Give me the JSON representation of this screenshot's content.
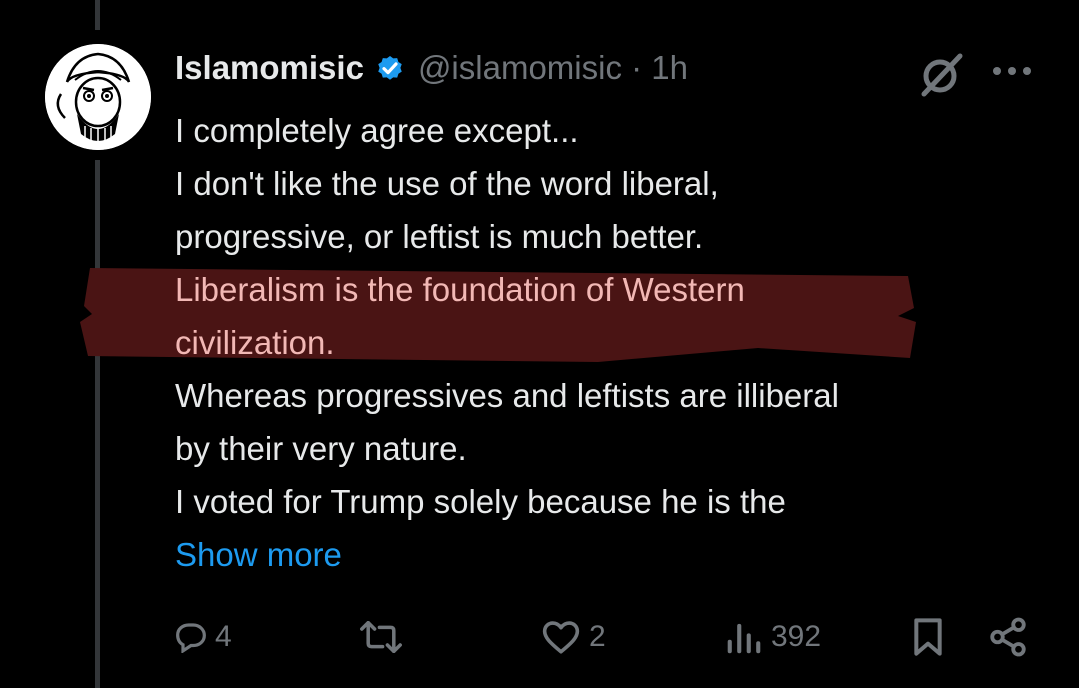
{
  "tweet": {
    "display_name": "Islamomisic",
    "handle_time": "@islamomisic · 1h",
    "lines": [
      "I completely agree except...",
      "I don't like the use of the word liberal,",
      "progressive, or leftist is much better.",
      "Liberalism is the foundation of Western",
      "civilization.",
      "Whereas progressives and leftists are illiberal",
      "by their very nature.",
      "I voted for Trump solely because he is the"
    ],
    "show_more": "Show more"
  },
  "actions": {
    "replies": "4",
    "reposts": "",
    "likes": "2",
    "views": "392"
  },
  "colors": {
    "background": "#000000",
    "text": "#e7e9ea",
    "muted": "#71767b",
    "link": "#1d9bf0",
    "verified": "#1d9bf0",
    "highlight": "#4a1414"
  },
  "icons": [
    "verified-badge-icon",
    "grok-icon",
    "more-icon",
    "reply-icon",
    "repost-icon",
    "like-icon",
    "views-icon",
    "bookmark-icon",
    "share-icon"
  ]
}
